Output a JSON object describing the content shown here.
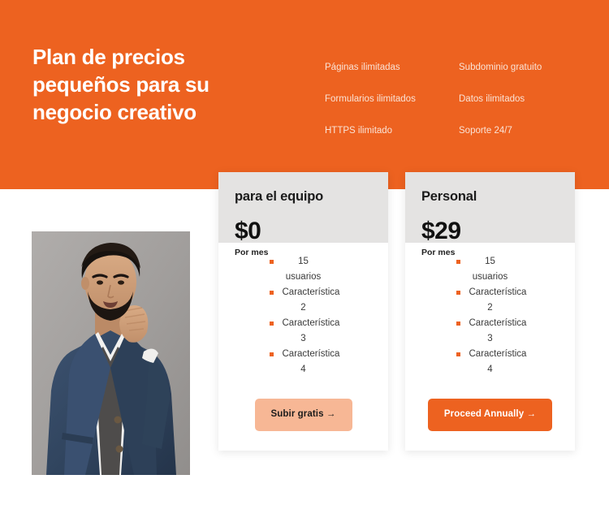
{
  "theme": {
    "orange": "#ED6220",
    "card_header_gray": "#E4E3E2",
    "cta_secondary_bg": "#F7B795",
    "page_bg": "#FFFFFF"
  },
  "hero": {
    "title": "Plan de precios\npequeños para su\nnegocio creativo",
    "features": [
      "Páginas ilimitadas",
      "Subdominio gratuito",
      "Formularios ilimitados",
      "Datos ilimitados",
      "HTTPS ilimitado",
      "Soporte 24/7"
    ]
  },
  "photo": {
    "alt": "man-in-blue-blazer-portrait"
  },
  "pricing": {
    "cards": [
      {
        "name": "para el equipo",
        "price": "$0",
        "period": "Por mes",
        "features": [
          "15 usuarios",
          "Característica 2",
          "Característica 3",
          "Característica 4"
        ],
        "cta": "Subir gratis →"
      },
      {
        "name": "Personal",
        "price": "$29",
        "period": "Por mes",
        "features": [
          "15 usuarios",
          "Característica 2",
          "Característica 3",
          "Característica 4"
        ],
        "cta": "Proceed Annually →"
      }
    ]
  }
}
